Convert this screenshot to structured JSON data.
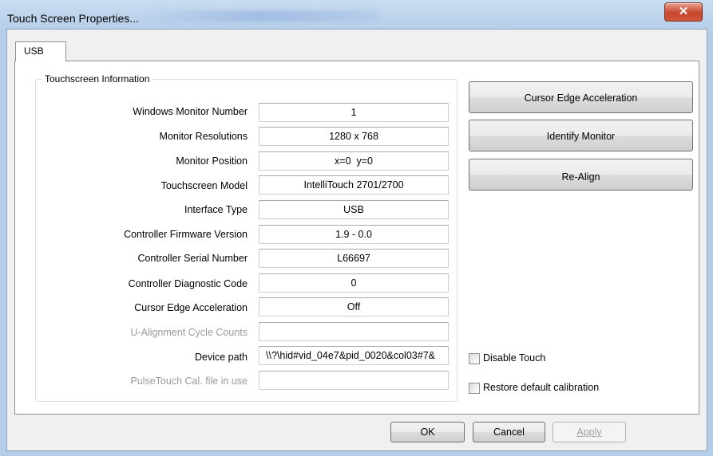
{
  "window": {
    "title": "Touch Screen Properties...",
    "close_glyph": "✕"
  },
  "tabs": [
    {
      "label": "USB"
    }
  ],
  "group": {
    "title": "Touchscreen Information"
  },
  "fields": [
    {
      "label": "Windows Monitor Number",
      "value": "1",
      "disabled": false
    },
    {
      "label": "Monitor Resolutions",
      "value": "1280 x 768",
      "disabled": false
    },
    {
      "label": "Monitor Position",
      "value": "x=0  y=0",
      "disabled": false
    },
    {
      "label": "Touchscreen Model",
      "value": "IntelliTouch 2701/2700",
      "disabled": false
    },
    {
      "label": "Interface Type",
      "value": "USB",
      "disabled": false
    },
    {
      "label": "Controller Firmware Version",
      "value": "1.9 - 0.0",
      "disabled": false
    },
    {
      "label": "Controller Serial Number",
      "value": "L66697",
      "disabled": false
    },
    {
      "label": "Controller Diagnostic Code",
      "value": "0",
      "disabled": false
    },
    {
      "label": "Cursor Edge Acceleration",
      "value": "Off",
      "disabled": false
    },
    {
      "label": "U-Alignment Cycle Counts",
      "value": "",
      "disabled": true
    },
    {
      "label": "Device path",
      "value": "\\\\?\\hid#vid_04e7&pid_0020&col03#7&",
      "disabled": false
    },
    {
      "label": "PulseTouch Cal. file in use",
      "value": "",
      "disabled": true
    }
  ],
  "actions": {
    "cursor_edge": "Cursor Edge Acceleration",
    "identify": "Identify Monitor",
    "realign": "Re-Align"
  },
  "checkboxes": {
    "disable_touch": {
      "label": "Disable Touch",
      "checked": false
    },
    "restore_calibration": {
      "label": "Restore default calibration",
      "checked": false
    }
  },
  "dialog_buttons": {
    "ok": "OK",
    "cancel": "Cancel",
    "apply": "Apply"
  }
}
